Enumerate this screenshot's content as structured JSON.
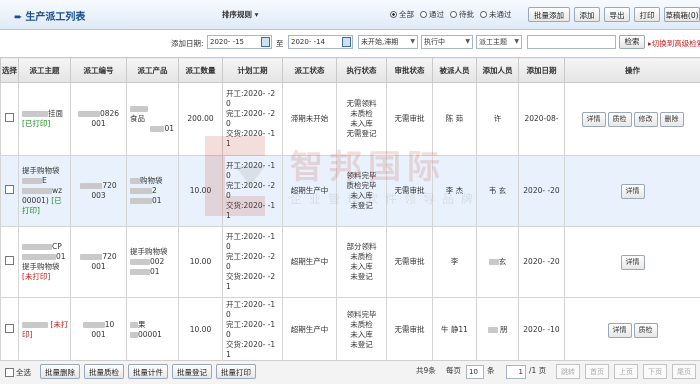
{
  "header": {
    "title": "生产派工列表",
    "sort_rule": "排序规则",
    "radios": [
      {
        "label": "全部",
        "checked": true
      },
      {
        "label": "通过",
        "checked": false
      },
      {
        "label": "待批",
        "checked": false
      },
      {
        "label": "未通过",
        "checked": false
      }
    ],
    "buttons": [
      "批量添加",
      "添加",
      "导出",
      "打印",
      "草稿箱(0)"
    ]
  },
  "filters": {
    "date_label": "添加日期:",
    "date_from": "2020-  -15",
    "date_sep": "至",
    "date_to": "2020-  -14",
    "plan_status": "未开始,滞期",
    "exec_status": "执行中",
    "subject": "派工主题",
    "keyword_value": "",
    "search_label": "检索",
    "switch_link": "切换到高级检索"
  },
  "table": {
    "columns": [
      "选择",
      "派工主题",
      "派工编号",
      "派工产品",
      "派工数量",
      "计划工期",
      "派工状态",
      "执行状态",
      "审批状态",
      "被派人员",
      "添加人员",
      "添加日期",
      "操作"
    ],
    "rows": [
      {
        "subject": "挂面",
        "print_tag": "[已打印]",
        "number_line1": "0826",
        "number_line2": "001",
        "product_line1": "食品",
        "product_line2": "01",
        "qty": "200.00",
        "plan": [
          "开工:2020-  -2",
          "0",
          "完工:2020-  -2",
          "0",
          "交货:2020-  -1",
          "1"
        ],
        "status": "滞期未开始",
        "exec": [
          "无需领料",
          "未质检",
          "未入库",
          "无需登记"
        ],
        "approval": "无需审批",
        "assignee": "陈  茹",
        "adder": "许",
        "date": "2020-08-",
        "actions": [
          "详情",
          "质检",
          "修改",
          "删除"
        ]
      },
      {
        "subject": "提手购物袋",
        "subject_line2": "E",
        "subject_line3": "wz",
        "subject_line4": "00001)",
        "print_tag": "[已打印]",
        "number_line1": "720",
        "number_line2": "003",
        "product_line1": "购物袋",
        "product_line2": "2",
        "product_line3": "01",
        "qty": "10.00",
        "plan": [
          "开工:2020-  -1",
          "0",
          "完工:2020-  -2",
          "0",
          "交货:2020-  -1",
          "1"
        ],
        "status": "超期生产中",
        "exec": [
          "领料完毕",
          "质检完毕",
          "未入库",
          "未登记"
        ],
        "approval": "无需审批",
        "assignee": "李  杰",
        "adder": "韦  玄",
        "date": "2020-  -20",
        "actions": [
          "详情"
        ]
      },
      {
        "subject": "CP",
        "subject_line2": "01",
        "subject_line3": "提手购物袋",
        "print_tag": "[未打印]",
        "number_line1": "720",
        "number_line2": "001",
        "product_line1": "提手购物袋",
        "product_line2": "002",
        "product_line3": "01",
        "qty": "10.00",
        "plan": [
          "开工:2020-  -1",
          "0",
          "完工:2020-  -2",
          "0",
          "交货:2020-  -2",
          "1"
        ],
        "status": "超期生产中",
        "exec": [
          "部分领料",
          "未质检",
          "未入库",
          "未登记"
        ],
        "approval": "无需审批",
        "assignee": "李",
        "adder": "玄",
        "date": "2020-  -20",
        "actions": [
          "详情"
        ]
      },
      {
        "subject": "",
        "print_tag": "[未打印]",
        "number_line1": "10",
        "number_line2": "001",
        "product_line1": "果",
        "product_line2": "00001",
        "qty": "10.00",
        "plan": [
          "开工:2020-  -1",
          "0",
          "完工:2020-  -1",
          "0",
          "交货:2020-  -1",
          "1"
        ],
        "status": "超期生产中",
        "exec": [
          "领料完毕",
          "未质检",
          "未入库",
          "未登记"
        ],
        "approval": "无需审批",
        "assignee": "牛  静11",
        "adder": "  朋",
        "date": "2020-  -10",
        "actions": [
          "详情",
          "质检"
        ]
      }
    ]
  },
  "footer": {
    "select_all": "全选",
    "buttons": [
      "批量删除",
      "批量质检",
      "批量计件",
      "批量登记",
      "批量打印"
    ],
    "total": "共9条",
    "per_page_label": "每页",
    "per_page": "10",
    "per_page_unit": "条",
    "page": "1",
    "page_total": "/1 页",
    "nav": [
      "跳转",
      "首页",
      "上页",
      "下页",
      "尾页"
    ]
  },
  "watermark": {
    "name": "智邦国际",
    "slogan": "企业管理软件领导品牌"
  },
  "colors": {
    "accent": "#1a4f8b",
    "printed": "#1e8a1e",
    "not_printed": "#c41a1a",
    "link": "#c41a1a"
  }
}
